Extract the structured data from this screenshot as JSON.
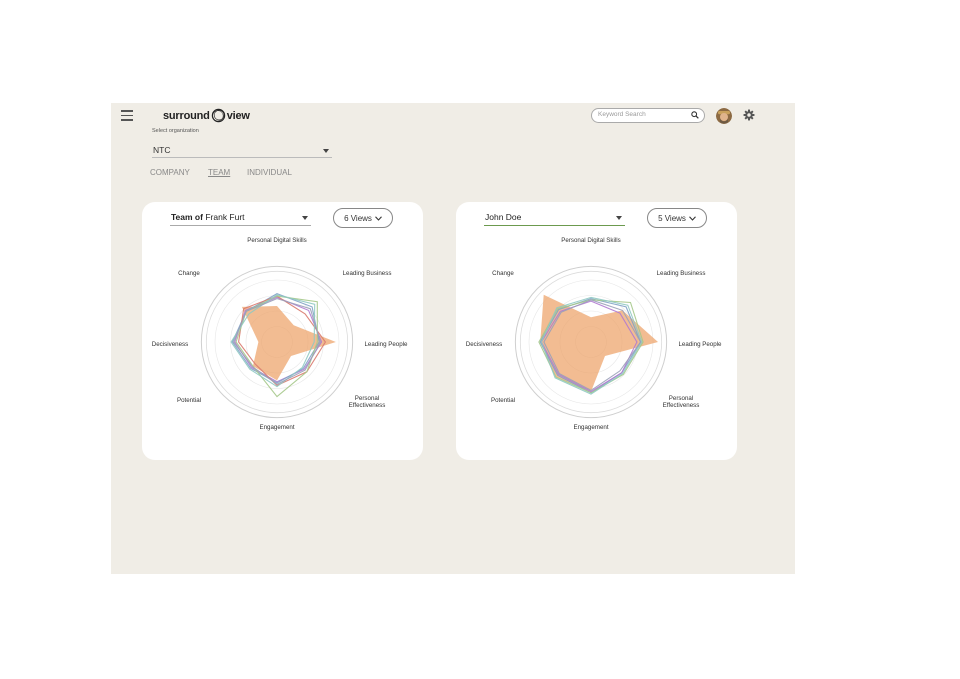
{
  "app": {
    "brand_left": "surround",
    "brand_right": "view",
    "org_label": "Select organization",
    "org_value": "NTC",
    "tabs": [
      "COMPANY",
      "TEAM",
      "INDIVIDUAL"
    ],
    "active_tab": "TEAM",
    "search_placeholder": "Keyword Search"
  },
  "cards": [
    {
      "title_prefix": "Team of",
      "title_name": "Frank Furt",
      "views_label": "6 Views",
      "axes": [
        "Personal Digital Skills",
        "Leading Business",
        "Leading People",
        "Personal Effectiveness",
        "Engagement",
        "Potential",
        "Decisiveness",
        "Change"
      ],
      "area": {
        "color": "#eda56e",
        "values": [
          0.58,
          0.38,
          0.95,
          0.32,
          0.62,
          0.55,
          0.3,
          0.8
        ]
      },
      "series": [
        {
          "color": "#b07ad0",
          "values": [
            0.72,
            0.72,
            0.72,
            0.62,
            0.64,
            0.58,
            0.68,
            0.72
          ]
        },
        {
          "color": "#7fa3c7",
          "values": [
            0.78,
            0.8,
            0.68,
            0.6,
            0.66,
            0.6,
            0.72,
            0.7
          ]
        },
        {
          "color": "#d97a6e",
          "values": [
            0.74,
            0.64,
            0.78,
            0.68,
            0.7,
            0.5,
            0.62,
            0.76
          ]
        },
        {
          "color": "#a5c88a",
          "values": [
            0.74,
            0.92,
            0.65,
            0.68,
            0.88,
            0.55,
            0.66,
            0.7
          ]
        },
        {
          "color": "#8fc9c2",
          "values": [
            0.76,
            0.86,
            0.6,
            0.58,
            0.72,
            0.62,
            0.74,
            0.64
          ]
        },
        {
          "color": "#9aa0b8",
          "values": [
            0.7,
            0.76,
            0.7,
            0.64,
            0.68,
            0.56,
            0.7,
            0.7
          ]
        }
      ]
    },
    {
      "title_prefix": "",
      "title_name": "John Doe",
      "views_label": "5 Views",
      "axes": [
        "Personal Digital Skills",
        "Leading Business",
        "Leading People",
        "Personal Effectiveness",
        "Engagement",
        "Potential",
        "Decisiveness",
        "Change"
      ],
      "area": {
        "color": "#eda56e",
        "values": [
          0.4,
          0.72,
          1.08,
          0.32,
          0.8,
          0.8,
          0.82,
          1.08
        ]
      },
      "series": [
        {
          "color": "#7fa3c7",
          "values": [
            0.7,
            0.8,
            0.8,
            0.7,
            0.82,
            0.76,
            0.82,
            0.74
          ]
        },
        {
          "color": "#a5c88a",
          "values": [
            0.68,
            0.9,
            0.84,
            0.74,
            0.82,
            0.8,
            0.84,
            0.76
          ]
        },
        {
          "color": "#b07ad0",
          "values": [
            0.66,
            0.66,
            0.74,
            0.7,
            0.8,
            0.74,
            0.8,
            0.7
          ]
        },
        {
          "color": "#8fc9c2",
          "values": [
            0.72,
            0.84,
            0.82,
            0.72,
            0.84,
            0.82,
            0.8,
            0.78
          ]
        },
        {
          "color": "#9aa0b8",
          "values": [
            0.68,
            0.72,
            0.8,
            0.66,
            0.78,
            0.72,
            0.76,
            0.68
          ]
        }
      ]
    }
  ]
}
